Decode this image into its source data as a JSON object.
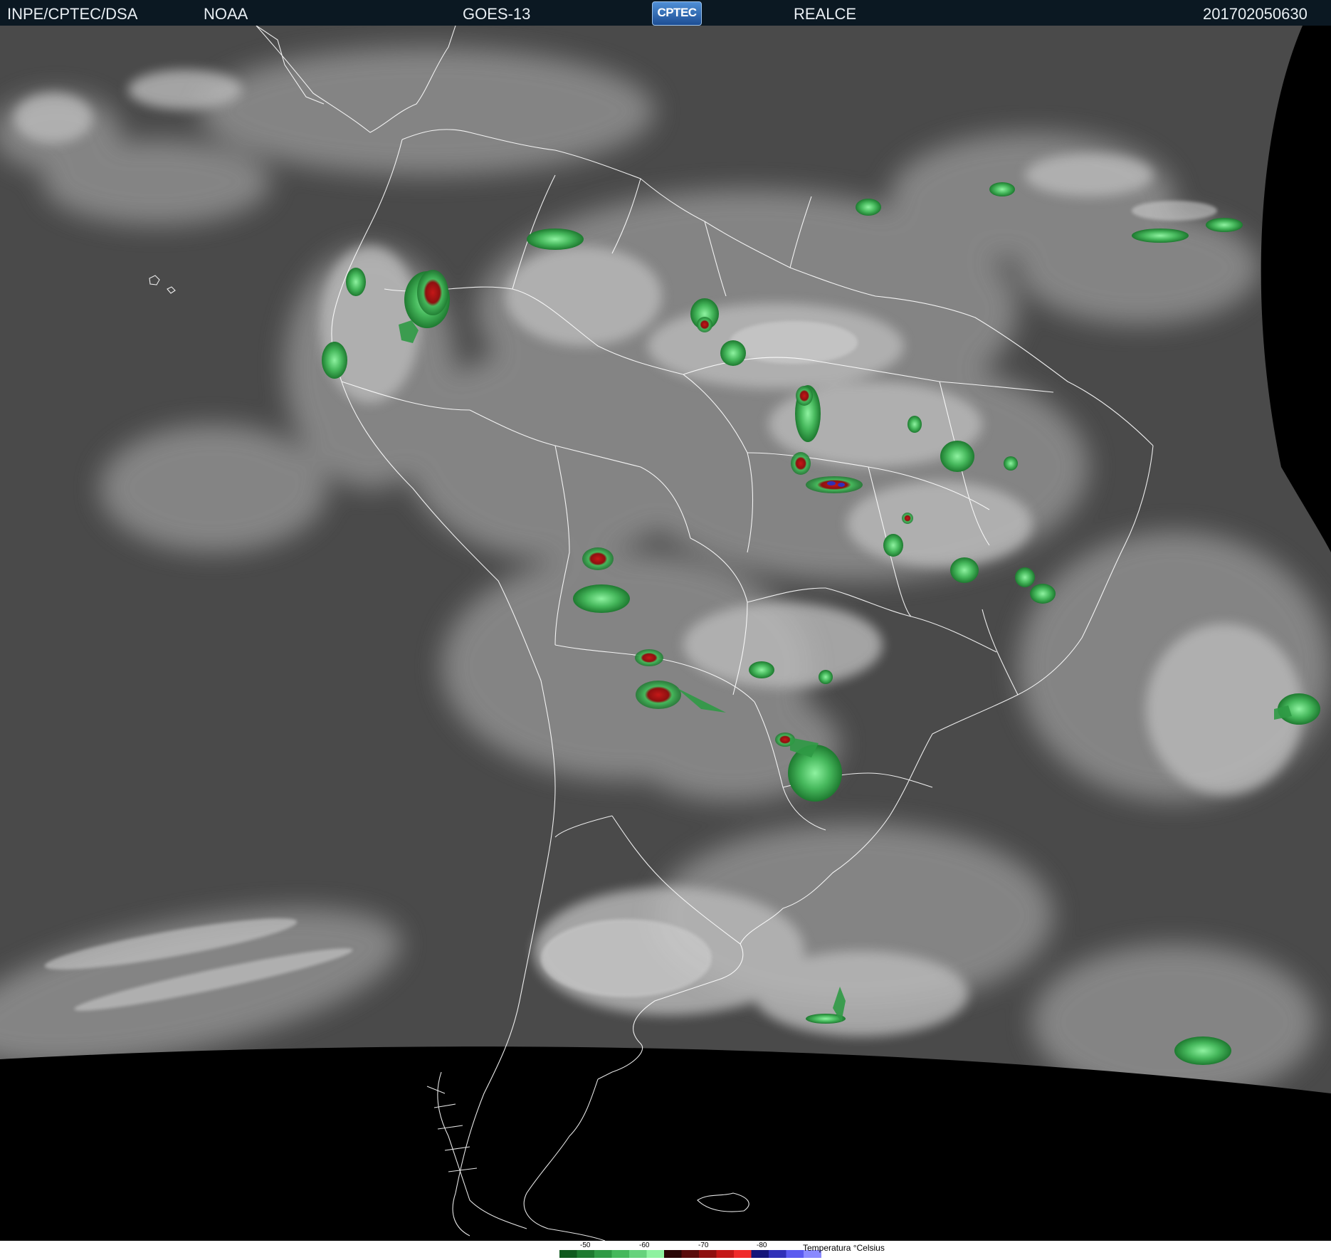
{
  "header": {
    "source": "INPE/CPTEC/DSA",
    "agency": "NOAA",
    "satellite": "GOES-13",
    "logo_text": "CPTEC",
    "product": "REALCE",
    "timestamp": "201702050630"
  },
  "legend": {
    "title": "Temperatura °Celsius",
    "ticks": [
      "-50",
      "-60",
      "-70",
      "-80"
    ],
    "colors": [
      "#0f5a1e",
      "#1e7a30",
      "#2f9a45",
      "#46b85c",
      "#66d27c",
      "#8ef2a0",
      "#2a0606",
      "#5a0b0b",
      "#8e1010",
      "#c41818",
      "#f02a2a",
      "#14147a",
      "#3030b8",
      "#5a5af0",
      "#8a8aff"
    ]
  },
  "colors": {
    "header_bg": "#0b1822",
    "space": "#000000",
    "land_border": "#ffffff",
    "cloud_cold": "#2ca84a",
    "cloud_very_cold": "#c41818"
  }
}
